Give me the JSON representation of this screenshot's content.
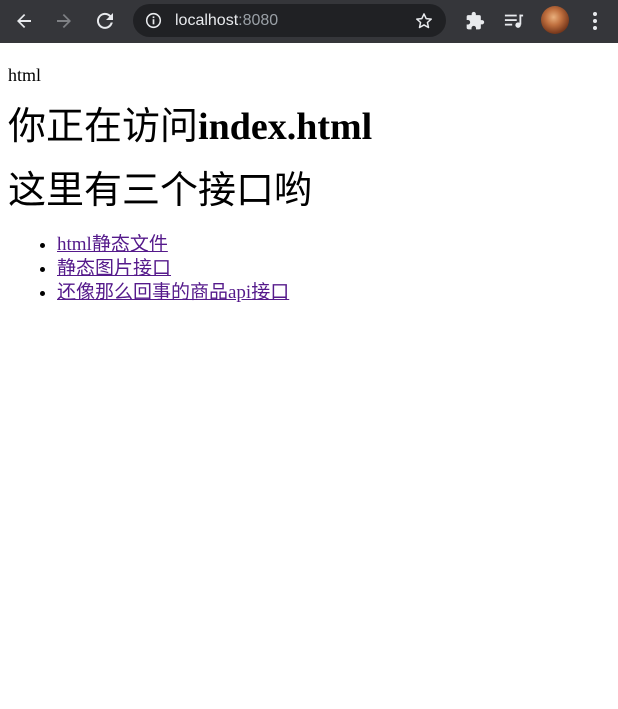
{
  "browser": {
    "url_host": "localhost",
    "url_port": ":8080",
    "icons": {
      "back": "arrow-left-icon",
      "forward": "arrow-right-icon",
      "reload": "reload-icon",
      "info": "info-icon",
      "bookmark": "star-icon",
      "extensions": "puzzle-icon",
      "media": "playlist-icon",
      "profile": "avatar",
      "menu": "kebab-menu-icon"
    },
    "colors": {
      "toolbar": "#35363a",
      "omnibox": "#202124",
      "icon": "#e8eaed",
      "icon_disabled": "#7f8185"
    }
  },
  "page": {
    "small_label": "html",
    "heading1_prefix": "你正在访问",
    "heading1_bold": "index.html",
    "heading2": "这里有三个接口哟",
    "links": [
      {
        "label": "html静态文件"
      },
      {
        "label": "静态图片接口"
      },
      {
        "label": "还像那么回事的商品api接口"
      }
    ],
    "link_color": "#551a8b"
  }
}
